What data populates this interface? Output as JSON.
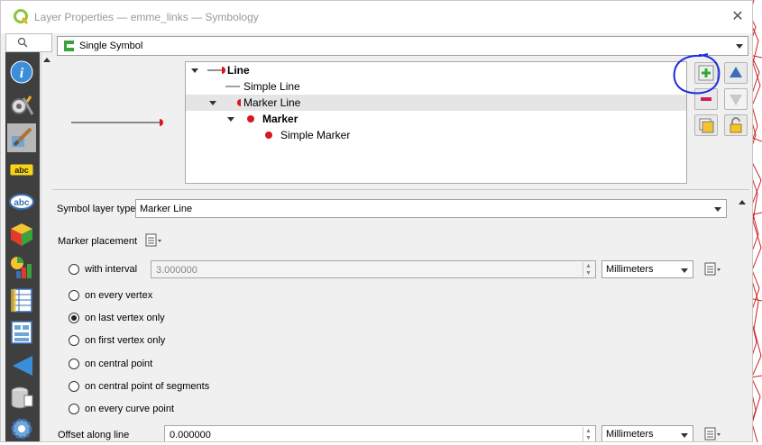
{
  "window": {
    "title": "Layer Properties — emme_links — Symbology",
    "close_glyph": "✕"
  },
  "sidebar": {
    "search_icon": "search-icon",
    "items": [
      {
        "name": "information",
        "icon": "info-icon"
      },
      {
        "name": "source",
        "icon": "settings-wrench-icon"
      },
      {
        "name": "symbology",
        "icon": "paintbrush-icon",
        "selected": true
      },
      {
        "name": "labels",
        "icon": "labels-abc-icon"
      },
      {
        "name": "masks",
        "icon": "masks-abc-icon"
      },
      {
        "name": "3d-view",
        "icon": "cube-icon"
      },
      {
        "name": "diagrams",
        "icon": "diagram-icon"
      },
      {
        "name": "fields",
        "icon": "fields-icon"
      },
      {
        "name": "attributes-form",
        "icon": "form-icon"
      },
      {
        "name": "joins",
        "icon": "joins-icon"
      },
      {
        "name": "auxiliary-storage",
        "icon": "database-icon"
      },
      {
        "name": "actions",
        "icon": "actions-gear-icon"
      }
    ]
  },
  "renderer": {
    "selected": "Single Symbol"
  },
  "symbol_tree": [
    {
      "label": "Line",
      "bold": true,
      "level": 0,
      "expanded": true,
      "icon": "line-marker-icon"
    },
    {
      "label": "Simple Line",
      "bold": false,
      "level": 1,
      "icon": "simple-line-icon"
    },
    {
      "label": "Marker Line",
      "bold": false,
      "level": 1,
      "expanded": true,
      "selected": true,
      "icon": "marker-line-icon"
    },
    {
      "label": "Marker",
      "bold": true,
      "level": 2,
      "expanded": true,
      "icon": "red-dot-icon"
    },
    {
      "label": "Simple Marker",
      "bold": false,
      "level": 3,
      "icon": "red-dot-icon"
    }
  ],
  "tree_buttons": [
    "add-layer-icon",
    "move-up-icon",
    "remove-layer-icon",
    "move-down-icon",
    "duplicate-layer-icon",
    "lock-layer-icon"
  ],
  "colors": {
    "marker_red": "#d7191c",
    "annotation_blue": "#1a2ee0",
    "map_red": "#d02020",
    "sidebar_bg": "#3f3f3f",
    "add_green": "#3aa33a"
  },
  "layer_type": {
    "label": "Symbol layer type",
    "value": "Marker Line"
  },
  "marker_placement": {
    "label": "Marker placement",
    "options": [
      {
        "label": "with interval",
        "checked": false
      },
      {
        "label": "on every vertex",
        "checked": false
      },
      {
        "label": "on last vertex only",
        "checked": true
      },
      {
        "label": "on first vertex only",
        "checked": false
      },
      {
        "label": "on central point",
        "checked": false
      },
      {
        "label": "on central point of segments",
        "checked": false
      },
      {
        "label": "on every curve point",
        "checked": false
      }
    ],
    "interval_value": "3.000000",
    "interval_unit": "Millimeters"
  },
  "offset_along_line": {
    "label": "Offset along line",
    "value": "0.000000",
    "unit": "Millimeters"
  }
}
